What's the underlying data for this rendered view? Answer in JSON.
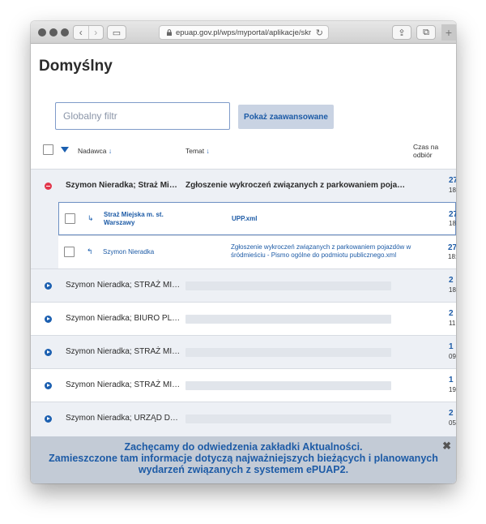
{
  "browser": {
    "url": "epuap.gov.pl/wps/myportal/aplikacje/skr",
    "back_glyph": "‹",
    "forward_glyph": "›",
    "sidebar_glyph": "▭",
    "reload_glyph": "↻",
    "share_glyph": "⇪",
    "tabs_glyph": "⧉",
    "new_tab_glyph": "+"
  },
  "page": {
    "title": "Domyślny"
  },
  "filter": {
    "placeholder": "Globalny filtr",
    "advanced_label": "Pokaż zaawansowane"
  },
  "table": {
    "headers": {
      "sender": "Nadawca",
      "subject": "Temat",
      "sort_arrow": "↓",
      "received_line1": "Czas na",
      "received_line2": "odbiór"
    },
    "expanded": {
      "sender": "Szymon Nieradka; Straż Mi…",
      "subject": "Zgłoszenie wykroczeń związanych z parkowaniem poja…",
      "date_main": "27",
      "date_sub": "18"
    },
    "children": [
      {
        "icon": "↳",
        "sender_line1": "Straż Miejska m. st.",
        "sender_line2": "Warszawy",
        "subject_line1": "UPP.xml",
        "subject_line2": "",
        "date_main": "27",
        "date_sub": "18:"
      },
      {
        "icon": "↰",
        "sender_line1": "Szymon Nieradka",
        "sender_line2": "",
        "subject_line1": "Zgłoszenie wykroczeń związanych z parkowaniem pojazdów w",
        "subject_line2": "śródmieściu - Pismo ogólne do podmiotu publicznego.xml",
        "date_main": "27",
        "date_sub": "18:"
      }
    ],
    "rows": [
      {
        "sender": "Szymon Nieradka; STRAŻ MI…",
        "date_main": "2",
        "date_sub": "18"
      },
      {
        "sender": "Szymon Nieradka; BIURO PL…",
        "date_main": "2",
        "date_sub": "11"
      },
      {
        "sender": "Szymon Nieradka; STRAŻ MI…",
        "date_main": "1",
        "date_sub": "09"
      },
      {
        "sender": "Szymon Nieradka; STRAŻ MI…",
        "date_main": "1",
        "date_sub": "19"
      },
      {
        "sender": "Szymon Nieradka; URZĄD D…",
        "date_main": "2",
        "date_sub": "05"
      }
    ]
  },
  "banner": {
    "line1": "Zachęcamy do odwiedzenia zakładki Aktualności.",
    "line2": "Zamieszczone tam informacje dotyczą najważniejszych bieżących i planowanych",
    "line3": "wydarzeń związanych z systemem ePUAP2.",
    "close_glyph": "✖"
  },
  "colors": {
    "accent": "#1d5ba6",
    "expanded_icon": "#e2364b",
    "banner_bg": "#c3cbd6",
    "row_gray": "#edf0f5"
  }
}
